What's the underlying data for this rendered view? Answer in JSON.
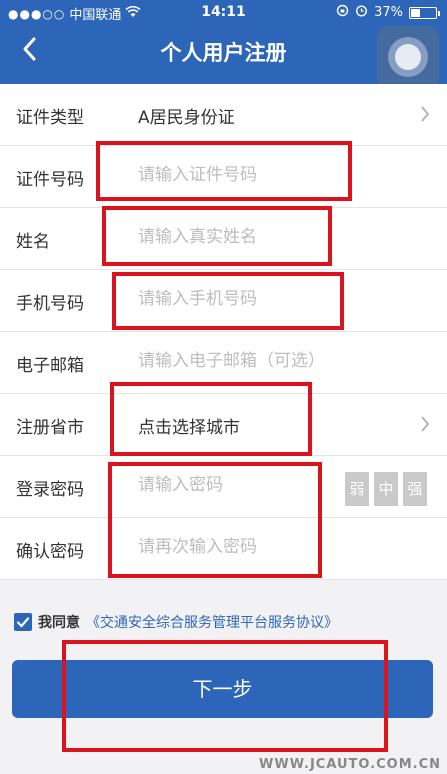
{
  "status_bar": {
    "carrier": "中国联通",
    "time": "14:11",
    "battery": "37%"
  },
  "nav": {
    "title": "个人用户注册"
  },
  "form": {
    "id_type": {
      "label": "证件类型",
      "value": "A居民身份证"
    },
    "id_number": {
      "label": "证件号码",
      "placeholder": "请输入证件号码"
    },
    "name": {
      "label": "姓名",
      "placeholder": "请输入真实姓名"
    },
    "phone": {
      "label": "手机号码",
      "placeholder": "请输入手机号码"
    },
    "email": {
      "label": "电子邮箱",
      "placeholder": "请输入电子邮箱（可选）"
    },
    "province": {
      "label": "注册省市",
      "value": "点击选择城市"
    },
    "password": {
      "label": "登录密码",
      "placeholder": "请输入密码",
      "strength": [
        "弱",
        "中",
        "强"
      ]
    },
    "confirm": {
      "label": "确认密码",
      "placeholder": "请再次输入密码"
    }
  },
  "agreement": {
    "checked": true,
    "text": "我同意",
    "link": "《交通安全综合服务管理平台服务协议》"
  },
  "next_button": {
    "label": "下一步"
  },
  "watermark": "WWW.JCAUTO.COM.CN",
  "colors": {
    "primary": "#2d66b8",
    "annotation": "#d9141d",
    "placeholder": "#bdbdbd"
  }
}
